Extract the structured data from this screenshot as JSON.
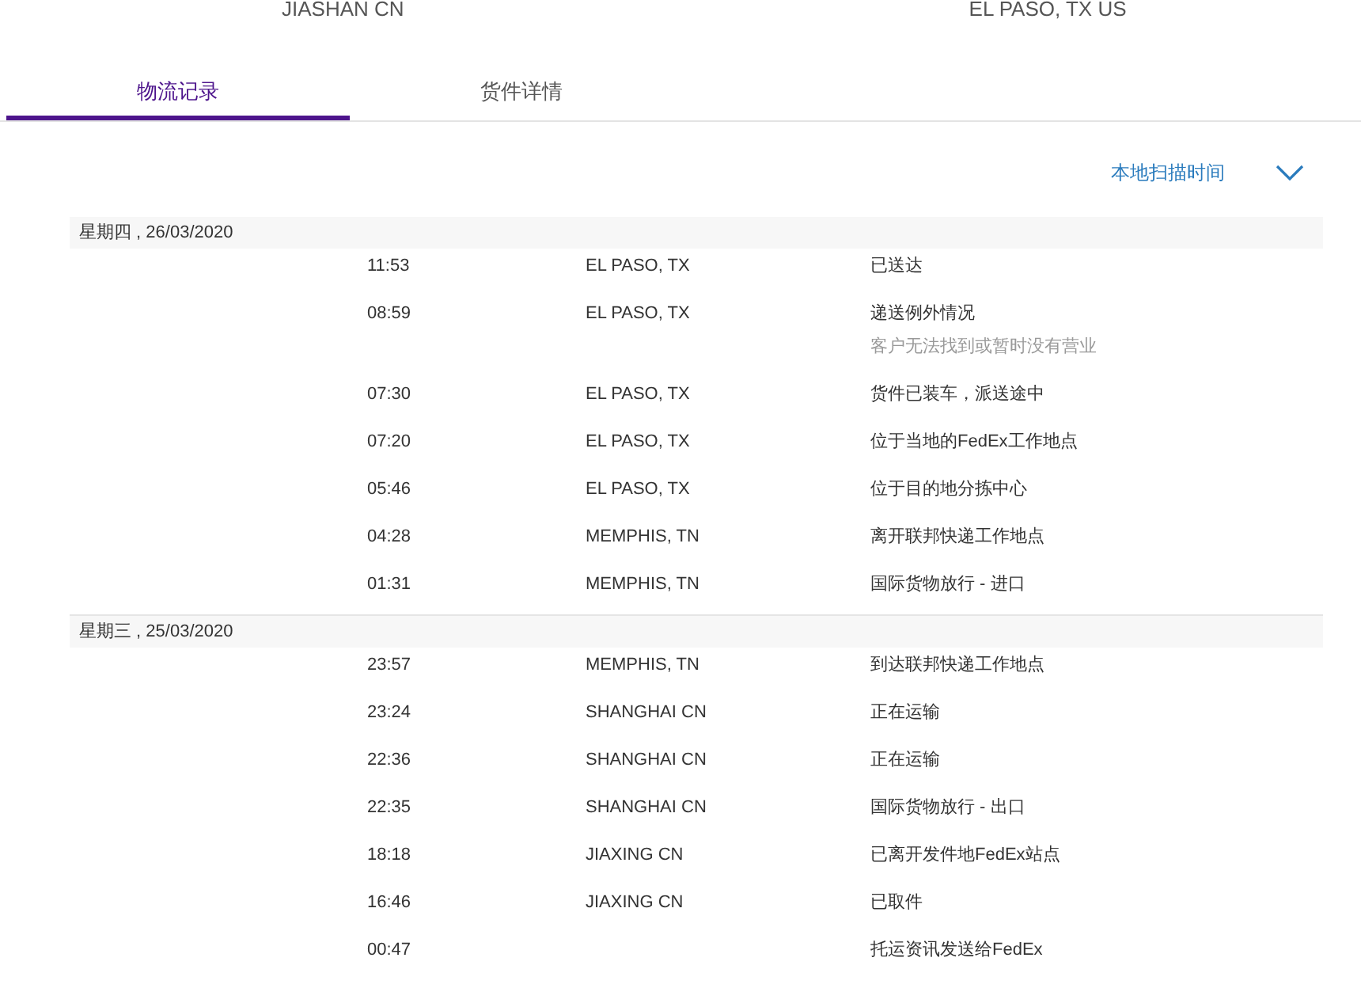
{
  "route": {
    "origin": "JIASHAN CN",
    "destination": "EL PASO, TX US"
  },
  "tabs": [
    {
      "label": "物流记录",
      "selected": true
    },
    {
      "label": "货件详情",
      "selected": false
    }
  ],
  "sort": {
    "label": "本地扫描时间"
  },
  "days": [
    {
      "date": "星期四 , 26/03/2020",
      "events": [
        {
          "time": "11:53",
          "location": "EL PASO, TX",
          "status": "已送达"
        },
        {
          "time": "08:59",
          "location": "EL PASO, TX",
          "status": "递送例外情况",
          "note": "客户无法找到或暂时没有营业"
        },
        {
          "time": "07:30",
          "location": "EL PASO, TX",
          "status": "货件已装车，派送途中"
        },
        {
          "time": "07:20",
          "location": "EL PASO, TX",
          "status": "位于当地的FedEx工作地点"
        },
        {
          "time": "05:46",
          "location": "EL PASO, TX",
          "status": "位于目的地分拣中心"
        },
        {
          "time": "04:28",
          "location": "MEMPHIS, TN",
          "status": "离开联邦快递工作地点"
        },
        {
          "time": "01:31",
          "location": "MEMPHIS, TN",
          "status": "国际货物放行 - 进口"
        }
      ]
    },
    {
      "date": "星期三 , 25/03/2020",
      "events": [
        {
          "time": "23:57",
          "location": "MEMPHIS, TN",
          "status": "到达联邦快递工作地点"
        },
        {
          "time": "23:24",
          "location": "SHANGHAI CN",
          "status": "正在运输"
        },
        {
          "time": "22:36",
          "location": "SHANGHAI CN",
          "status": "正在运输"
        },
        {
          "time": "22:35",
          "location": "SHANGHAI CN",
          "status": "国际货物放行 - 出口"
        },
        {
          "time": "18:18",
          "location": "JIAXING CN",
          "status": "已离开发件地FedEx站点"
        },
        {
          "time": "16:46",
          "location": "JIAXING CN",
          "status": "已取件"
        },
        {
          "time": "00:47",
          "status": "托运资讯发送给FedEx"
        }
      ]
    }
  ]
}
